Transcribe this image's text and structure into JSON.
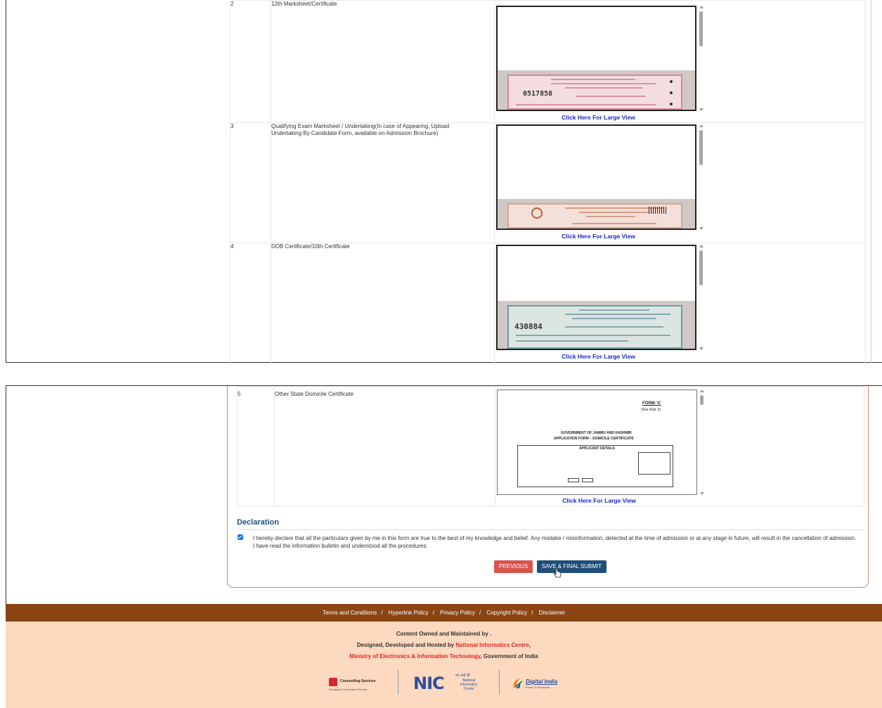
{
  "documents_top": [
    {
      "num": "2",
      "name": "12th Marksheet/Certificate",
      "preview": "marksheet-pink",
      "ms_number": "0517858",
      "link": "Click Here For Large View"
    },
    {
      "num": "3",
      "name": "Qualifying Exam Marksheet / Undertaking(In case of Appearing, Upload Undertaking By Candidate Form, available on Admission Brochure)",
      "preview": "marksheet-peach",
      "link": "Click Here For Large View"
    },
    {
      "num": "4",
      "name": "DOB Certificate/10th Certificate",
      "preview": "marksheet-teal",
      "ms_number": "430884",
      "link": "Click Here For Large View"
    }
  ],
  "documents_bottom": [
    {
      "num": "5",
      "name": "Other State Domicile Certificate",
      "preview": "domicile-form",
      "link": "Click Here For Large View",
      "form": {
        "title": "FORM-'A'",
        "subtitle": "(See Rule 3)",
        "gov": "GOVERNMENT OF JAMMU AND KASHMIR",
        "app": "APPLICATION FORM – DOMICILE CERTIFICATE",
        "section": "APPLICANT DETAILS"
      }
    }
  ],
  "declaration": {
    "title": "Declaration",
    "checked": true,
    "text": "I hereby declare that all the particulars given by me in this form are true to the best of my knowledge and belief. Any mistake / misinformation, detected at the time of admission or at any stage in future, will result in the cancellation of admission. I have read the information bulletin and understood all the procedures."
  },
  "buttons": {
    "previous": "PREVIOUS",
    "submit": "SAVE & FINAL SUBMIT"
  },
  "footer": {
    "links": [
      "Terms and Conditions",
      "Hyperlink Policy",
      "Privacy Policy",
      "Copyright Policy",
      "Disclaimer"
    ],
    "separator": "/",
    "owned": "Content Owned and Maintained by .",
    "designed_prefix": "Designed, Developed and Hosted by ",
    "nic": "National Informatics Centre",
    "designed_suffix": ",",
    "ministry": "Ministry of Electronics & Information Technology",
    "gov": ", Government of India",
    "logo1_title": "Counselling Services",
    "logo1_sub": "Simplifying The Admission Process",
    "logo2_text": "NIC",
    "logo2_hindi": "एन आई सी",
    "logo2_label": "National Informatics Centre",
    "logo3_title": "Digital India",
    "logo3_sub": "Power To Empower"
  },
  "colors": {
    "footer_bar": "#8b4513",
    "footer_bg": "#fcd9bf",
    "link": "#1a28c8",
    "declaration": "#1f4e8c",
    "btn_prev": "#d9534f",
    "btn_submit": "#1f4e79"
  }
}
